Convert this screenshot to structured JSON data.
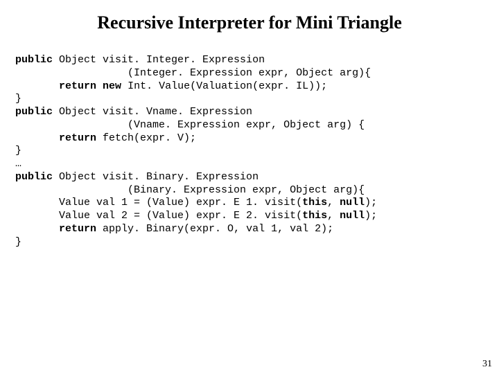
{
  "title": "Recursive Interpreter for Mini Triangle",
  "page_number": "31",
  "kw": {
    "public": "public",
    "return": "return",
    "new": "new",
    "this": "this",
    "null": "null"
  },
  "code": {
    "l1a": " Object visit. Integer. Expression",
    "l2": "                  (Integer. Expression expr, Object arg){",
    "l3a": "       ",
    "l3b": " Int. Value(Valuation(expr. IL));",
    "l4": "}",
    "l5a": " Object visit. Vname. Expression",
    "l6": "                  (Vname. Expression expr, Object arg) {",
    "l7": " fetch(expr. V);",
    "l8": "}",
    "l9": "…",
    "l10a": " Object visit. Binary. Expression",
    "l11": "                  (Binary. Expression expr, Object arg){",
    "l12a": "       Value val 1 = (Value) expr. E 1. visit(",
    "l12b": ", ",
    "l12c": ");",
    "l13a": "       Value val 2 = (Value) expr. E 2. visit(",
    "l14a": " apply. Binary(expr. O, val 1, val 2);",
    "l15": "}"
  }
}
